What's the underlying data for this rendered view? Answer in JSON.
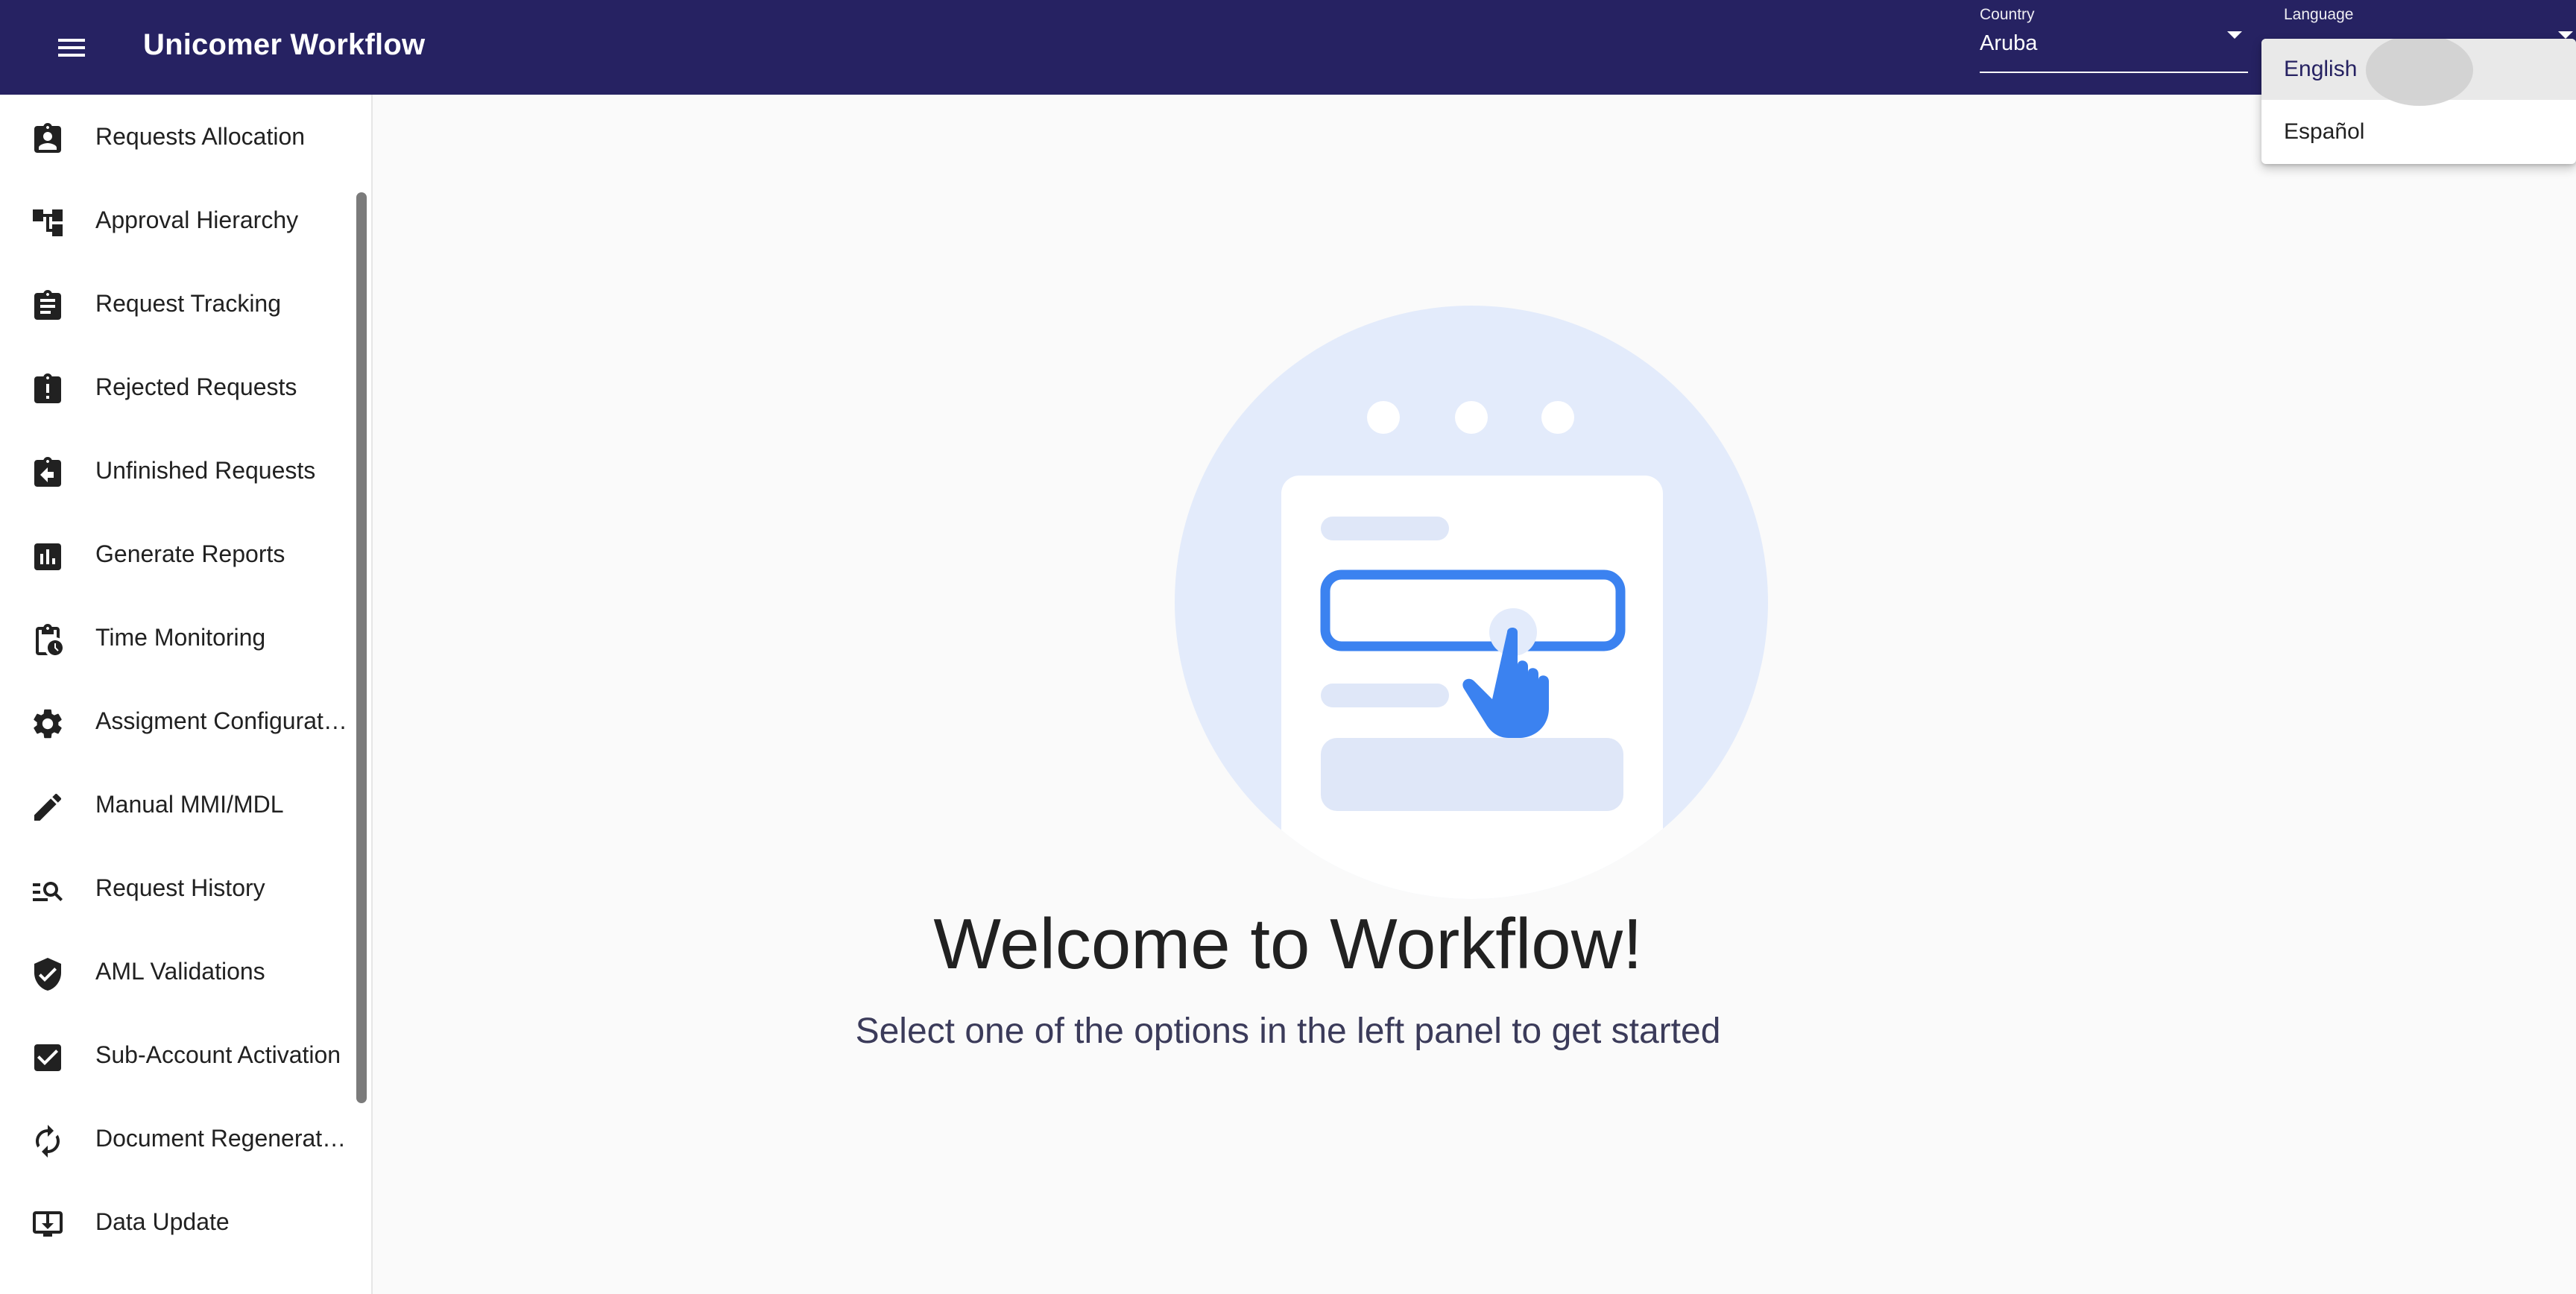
{
  "header": {
    "title": "Unicomer Workflow",
    "country": {
      "label": "Country",
      "value": "Aruba"
    },
    "language": {
      "label": "Language",
      "value": "English"
    }
  },
  "language_menu": {
    "options": [
      "English",
      "Español"
    ],
    "selected": "English"
  },
  "sidebar": {
    "items": [
      {
        "label": "Requests Allocation",
        "icon": "assignment-ind-icon"
      },
      {
        "label": "Approval Hierarchy",
        "icon": "hierarchy-icon"
      },
      {
        "label": "Request Tracking",
        "icon": "assignment-icon"
      },
      {
        "label": "Rejected Requests",
        "icon": "assignment-late-icon"
      },
      {
        "label": "Unfinished Requests",
        "icon": "assignment-return-icon"
      },
      {
        "label": "Generate Reports",
        "icon": "assessment-icon"
      },
      {
        "label": "Time Monitoring",
        "icon": "pending-actions-icon"
      },
      {
        "label": "Assigment Configuration",
        "icon": "gear-icon"
      },
      {
        "label": "Manual MMI/MDL",
        "icon": "pencil-icon"
      },
      {
        "label": "Request History",
        "icon": "manage-search-icon"
      },
      {
        "label": "AML Validations",
        "icon": "verified-shield-icon"
      },
      {
        "label": "Sub-Account Activation",
        "icon": "checkbox-icon"
      },
      {
        "label": "Document Regeneration",
        "icon": "sync-icon"
      },
      {
        "label": "Data Update",
        "icon": "download-to-screen-icon"
      }
    ]
  },
  "main": {
    "welcome_title": "Welcome to Workflow!",
    "welcome_subtitle": "Select one of the options in the left panel to get started"
  },
  "colors": {
    "appbar": "#262262",
    "accent": "#3b82f0",
    "illustration_bg": "#e3ebfb",
    "background": "#fafafa"
  }
}
